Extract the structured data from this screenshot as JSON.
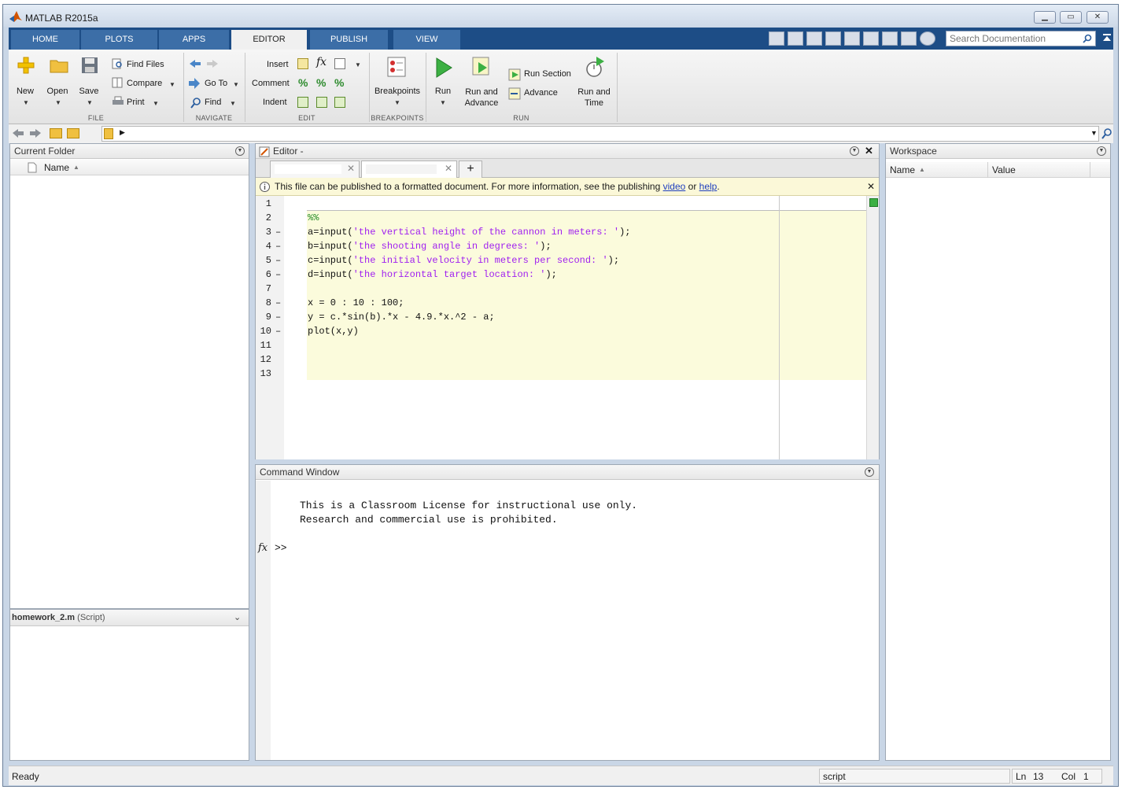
{
  "window": {
    "title": "MATLAB R2015a"
  },
  "tabs": [
    "HOME",
    "PLOTS",
    "APPS",
    "EDITOR",
    "PUBLISH",
    "VIEW"
  ],
  "active_tab": "EDITOR",
  "search": {
    "placeholder": "Search Documentation"
  },
  "ribbon": {
    "file": {
      "label": "FILE",
      "new": "New",
      "open": "Open",
      "save": "Save",
      "find_files": "Find Files",
      "compare": "Compare",
      "print": "Print"
    },
    "navigate": {
      "label": "NAVIGATE",
      "go_to": "Go To",
      "find": "Find"
    },
    "edit": {
      "label": "EDIT",
      "insert": "Insert",
      "comment": "Comment",
      "indent": "Indent"
    },
    "breakpoints": {
      "label": "BREAKPOINTS",
      "breakpoints": "Breakpoints"
    },
    "run": {
      "label": "RUN",
      "run": "Run",
      "run_and_advance_1": "Run and",
      "run_and_advance_2": "Advance",
      "run_section": "Run Section",
      "advance": "Advance",
      "run_and_time_1": "Run and",
      "run_and_time_2": "Time"
    }
  },
  "current_folder": {
    "title": "Current Folder",
    "col_name": "Name"
  },
  "details": {
    "file": "homework_2.m",
    "type": "(Script)"
  },
  "editor": {
    "title": "Editor -",
    "info_text": "This file can be published to a formatted document. For more information, see the publishing",
    "info_link_video": "video",
    "info_or": "or",
    "info_link_help": "help",
    "info_period": ".",
    "lines": [
      {
        "n": "1",
        "dash": "",
        "code": "",
        "str": "",
        "tail": ""
      },
      {
        "n": "2",
        "dash": "",
        "code": "",
        "cmt": "%%"
      },
      {
        "n": "3",
        "dash": "–",
        "code": "a=input(",
        "str": "'the vertical height of the cannon in meters: '",
        "tail": ");"
      },
      {
        "n": "4",
        "dash": "–",
        "code": "b=input(",
        "str": "'the shooting angle in degrees: '",
        "tail": ");"
      },
      {
        "n": "5",
        "dash": "–",
        "code": "c=input(",
        "str": "'the initial velocity in meters per second: '",
        "tail": ");"
      },
      {
        "n": "6",
        "dash": "–",
        "code": "d=input(",
        "str": "'the horizontal target location: '",
        "tail": ");"
      },
      {
        "n": "7",
        "dash": "",
        "code": "",
        "str": "",
        "tail": ""
      },
      {
        "n": "8",
        "dash": "–",
        "code": "x = 0 : 10 : 100;",
        "str": "",
        "tail": ""
      },
      {
        "n": "9",
        "dash": "–",
        "code": "y = c.*sin(b).*x - 4.9.*x.^2 - a;",
        "str": "",
        "tail": ""
      },
      {
        "n": "10",
        "dash": "–",
        "code": "plot(x,y)",
        "str": "",
        "tail": ""
      },
      {
        "n": "11",
        "dash": "",
        "code": "",
        "str": "",
        "tail": ""
      },
      {
        "n": "12",
        "dash": "",
        "code": "",
        "str": "",
        "tail": ""
      },
      {
        "n": "13",
        "dash": "",
        "code": "",
        "str": "",
        "tail": ""
      }
    ]
  },
  "command_window": {
    "title": "Command Window",
    "line1": "This is a Classroom License for instructional use only.",
    "line2": "Research and commercial use is prohibited.",
    "prompt": ">>"
  },
  "workspace": {
    "title": "Workspace",
    "col_name": "Name",
    "col_value": "Value"
  },
  "status": {
    "text": "Ready",
    "mode": "script",
    "ln_label": "Ln",
    "ln": "13",
    "col_label": "Col",
    "col": "1"
  }
}
